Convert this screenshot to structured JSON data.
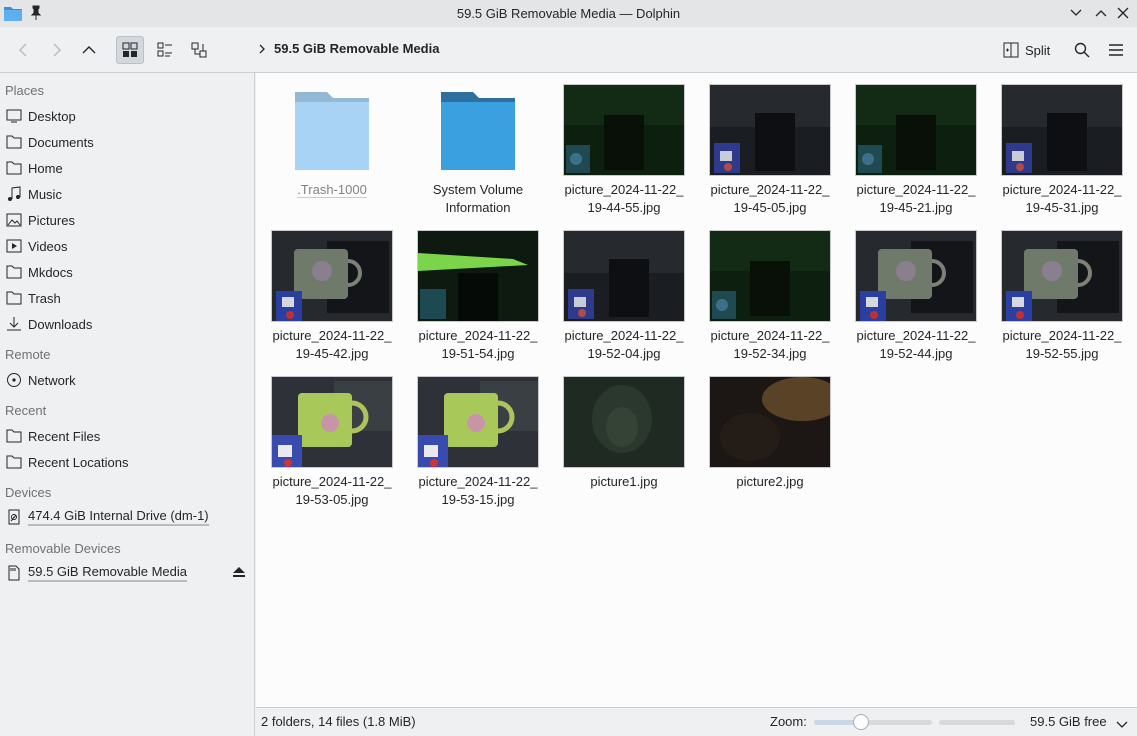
{
  "window": {
    "title": "59.5 GiB Removable Media — Dolphin",
    "app_icon": "folder-icon",
    "pin_icon": "pin-icon"
  },
  "toolbar": {
    "back_icon": "back-arrow-icon",
    "forward_icon": "forward-arrow-icon",
    "up_icon": "up-arrow-icon",
    "view_icons": [
      "icons-view-icon",
      "compact-view-icon",
      "details-view-icon"
    ],
    "breadcrumb": "59.5 GiB Removable Media",
    "split_label": "Split",
    "search_icon": "search-icon",
    "menu_icon": "hamburger-menu-icon"
  },
  "sidebar": {
    "places_title": "Places",
    "places": [
      {
        "label": "Desktop",
        "icon": "desktop-icon"
      },
      {
        "label": "Documents",
        "icon": "documents-icon"
      },
      {
        "label": "Home",
        "icon": "home-icon"
      },
      {
        "label": "Music",
        "icon": "music-icon"
      },
      {
        "label": "Pictures",
        "icon": "pictures-icon"
      },
      {
        "label": "Videos",
        "icon": "videos-icon"
      },
      {
        "label": "Mkdocs",
        "icon": "folder-icon"
      },
      {
        "label": "Trash",
        "icon": "trash-icon"
      },
      {
        "label": "Downloads",
        "icon": "downloads-icon"
      }
    ],
    "remote_title": "Remote",
    "remote": [
      {
        "label": "Network",
        "icon": "network-icon"
      }
    ],
    "recent_title": "Recent",
    "recent": [
      {
        "label": "Recent Files",
        "icon": "recent-files-icon"
      },
      {
        "label": "Recent Locations",
        "icon": "recent-locations-icon"
      }
    ],
    "devices_title": "Devices",
    "devices": [
      {
        "label": "474.4 GiB Internal Drive (dm-1)",
        "icon": "hard-drive-icon"
      }
    ],
    "removable_title": "Removable Devices",
    "removable": [
      {
        "label": "59.5 GiB Removable Media",
        "icon": "sd-card-icon",
        "eject_icon": "eject-icon"
      }
    ]
  },
  "files": [
    {
      "line1": ".Trash-1000",
      "line2": "",
      "kind": "folder-light",
      "hidden": true
    },
    {
      "line1": "System Volume",
      "line2": "Information",
      "kind": "folder-dark"
    },
    {
      "line1": "picture_2024-11-22_",
      "line2": "19-44-55.jpg",
      "kind": "dark-green"
    },
    {
      "line1": "picture_2024-11-22_",
      "line2": "19-45-05.jpg",
      "kind": "dark-desk"
    },
    {
      "line1": "picture_2024-11-22_",
      "line2": "19-45-21.jpg",
      "kind": "dark-green"
    },
    {
      "line1": "picture_2024-11-22_",
      "line2": "19-45-31.jpg",
      "kind": "dark-desk"
    },
    {
      "line1": "picture_2024-11-22_",
      "line2": "19-45-42.jpg",
      "kind": "mug-dark"
    },
    {
      "line1": "picture_2024-11-22_",
      "line2": "19-51-54.jpg",
      "kind": "green-bar"
    },
    {
      "line1": "picture_2024-11-22_",
      "line2": "19-52-04.jpg",
      "kind": "dark-desk"
    },
    {
      "line1": "picture_2024-11-22_",
      "line2": "19-52-34.jpg",
      "kind": "dark-green"
    },
    {
      "line1": "picture_2024-11-22_",
      "line2": "19-52-44.jpg",
      "kind": "mug-dark"
    },
    {
      "line1": "picture_2024-11-22_",
      "line2": "19-52-55.jpg",
      "kind": "mug-dark"
    },
    {
      "line1": "picture_2024-11-22_",
      "line2": "19-53-05.jpg",
      "kind": "mug-bright"
    },
    {
      "line1": "picture_2024-11-22_",
      "line2": "19-53-15.jpg",
      "kind": "mug-bright"
    },
    {
      "line1": "picture1.jpg",
      "line2": "",
      "kind": "blur-green"
    },
    {
      "line1": "picture2.jpg",
      "line2": "",
      "kind": "blur-brown"
    }
  ],
  "statusbar": {
    "summary": "2 folders, 14 files (1.8 MiB)",
    "zoom_label": "Zoom:",
    "zoom_level": 0.4,
    "free_space": "59.5 GiB free",
    "used_fraction": 0.0
  }
}
